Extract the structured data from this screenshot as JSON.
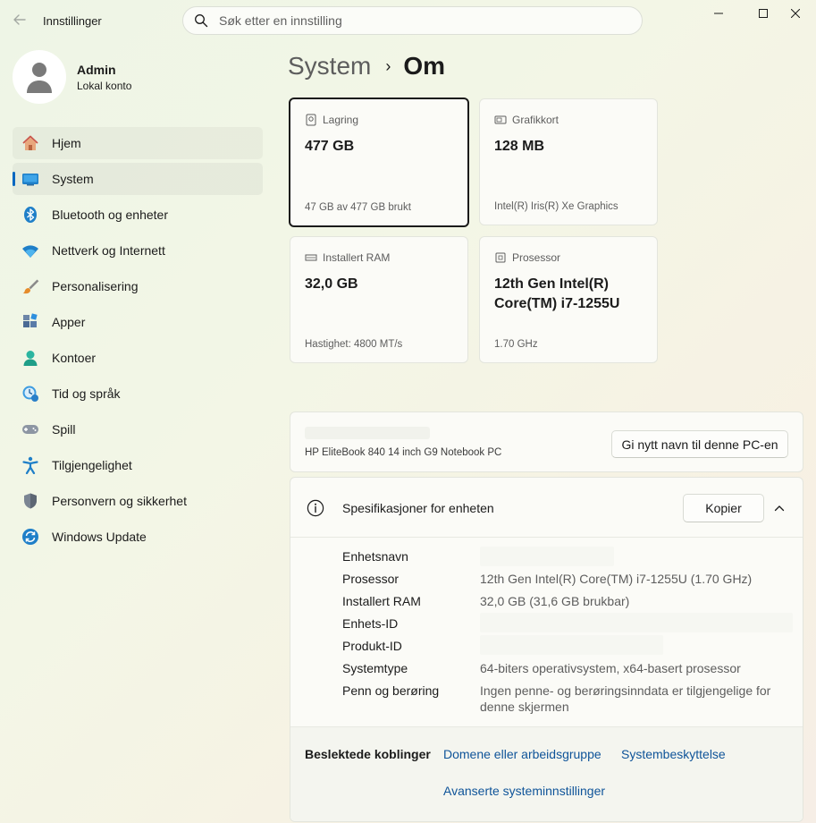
{
  "window": {
    "app_title": "Innstillinger",
    "back_icon": "arrow-left-icon",
    "controls": [
      "minimize-icon",
      "maximize-icon",
      "close-icon"
    ]
  },
  "search": {
    "placeholder": "Søk etter en innstilling"
  },
  "profile": {
    "name": "Admin",
    "subtitle": "Lokal konto"
  },
  "sidebar": {
    "items": [
      {
        "label": "Hjem",
        "icon": "home-icon",
        "state": "hover"
      },
      {
        "label": "System",
        "icon": "system-monitor-icon",
        "state": "active"
      },
      {
        "label": "Bluetooth og enheter",
        "icon": "bluetooth-icon"
      },
      {
        "label": "Nettverk og Internett",
        "icon": "wifi-icon"
      },
      {
        "label": "Personalisering",
        "icon": "brush-icon"
      },
      {
        "label": "Apper",
        "icon": "apps-icon"
      },
      {
        "label": "Kontoer",
        "icon": "account-icon"
      },
      {
        "label": "Tid og språk",
        "icon": "clock-globe-icon"
      },
      {
        "label": "Spill",
        "icon": "gamepad-icon"
      },
      {
        "label": "Tilgjengelighet",
        "icon": "accessibility-icon"
      },
      {
        "label": "Personvern og sikkerhet",
        "icon": "shield-icon"
      },
      {
        "label": "Windows Update",
        "icon": "update-icon"
      }
    ]
  },
  "breadcrumb": {
    "parent": "System",
    "separator": "›",
    "current": "Om"
  },
  "cards": {
    "storage": {
      "label": "Lagring",
      "value": "477 GB",
      "footer": "47 GB av 477 GB brukt"
    },
    "graphics": {
      "label": "Grafikkort",
      "value": "128 MB",
      "footer": "Intel(R) Iris(R) Xe Graphics"
    },
    "ram": {
      "label": "Installert RAM",
      "value": "32,0 GB",
      "footer": "Hastighet: 4800 MT/s"
    },
    "cpu": {
      "label": "Prosessor",
      "value": "12th Gen Intel(R) Core(TM) i7-1255U",
      "footer": "1.70 GHz"
    }
  },
  "device": {
    "model": "HP EliteBook 840 14 inch G9 Notebook PC",
    "rename_button": "Gi nytt navn til denne PC-en"
  },
  "specs": {
    "title": "Spesifikasjoner for enheten",
    "copy_button": "Kopier",
    "rows": [
      {
        "label": "Enhetsnavn",
        "value": ""
      },
      {
        "label": "Prosessor",
        "value": "12th Gen Intel(R) Core(TM) i7-1255U (1.70 GHz)"
      },
      {
        "label": "Installert RAM",
        "value": "32,0 GB (31,6 GB brukbar)"
      },
      {
        "label": "Enhets-ID",
        "value": ""
      },
      {
        "label": "Produkt-ID",
        "value": ""
      },
      {
        "label": "Systemtype",
        "value": "64-biters operativsystem, x64-basert prosessor"
      },
      {
        "label": "Penn og berøring",
        "value": "Ingen penne- og berøringsinndata er tilgjengelige for denne skjermen"
      }
    ]
  },
  "related": {
    "label": "Beslektede koblinger",
    "links": [
      "Domene eller arbeidsgruppe",
      "Systembeskyttelse",
      "Avanserte systeminnstillinger"
    ]
  },
  "colors": {
    "accent": "#0067c0",
    "link": "#0f5499"
  }
}
